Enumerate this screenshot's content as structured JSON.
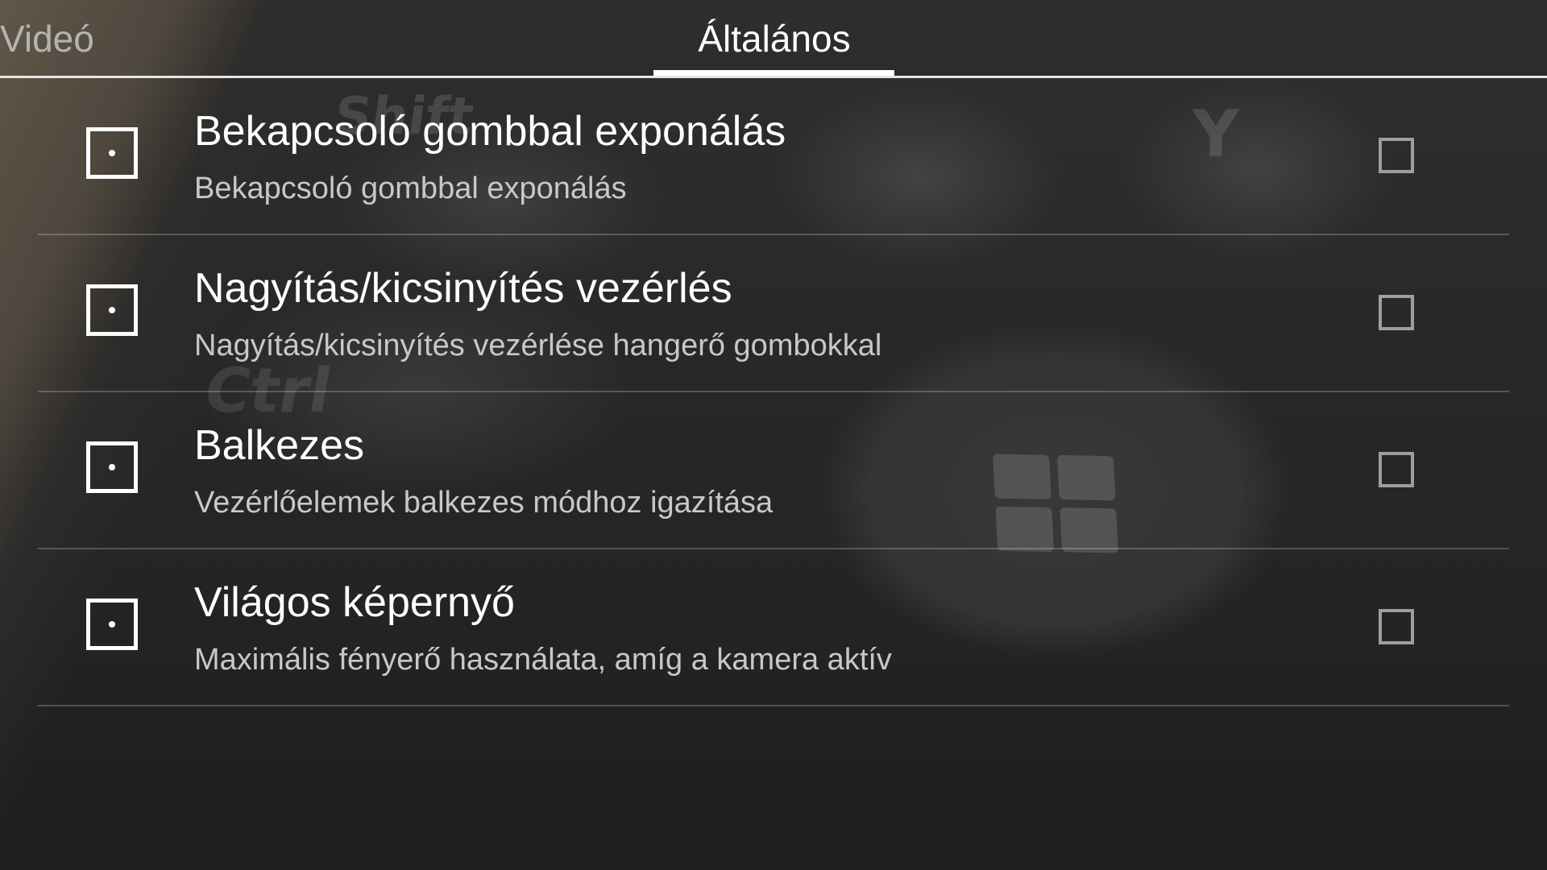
{
  "tabs": [
    {
      "label": "Videó",
      "selected": false
    },
    {
      "label": "Általános",
      "selected": true
    }
  ],
  "settings": [
    {
      "title": "Bekapcsoló gombbal exponálás",
      "subtitle": "Bekapcsoló gombbal exponálás",
      "checked": false
    },
    {
      "title": "Nagyítás/kicsinyítés vezérlés",
      "subtitle": "Nagyítás/kicsinyítés vezérlése hangerő gombokkal",
      "checked": false
    },
    {
      "title": "Balkezes",
      "subtitle": "Vezérlőelemek balkezes módhoz igazítása",
      "checked": false
    },
    {
      "title": "Világos képernyő",
      "subtitle": "Maximális fényerő használata, amíg a kamera aktív",
      "checked": false
    }
  ],
  "background_text": {
    "key_shift": "Shift",
    "key_ctrl": "Ctrl",
    "key_y": "Y"
  },
  "colors": {
    "text_primary": "#ffffff",
    "text_secondary": "#c8c8c8",
    "tab_inactive": "#b3b3b3",
    "checkbox_border": "#9e9e9e"
  }
}
